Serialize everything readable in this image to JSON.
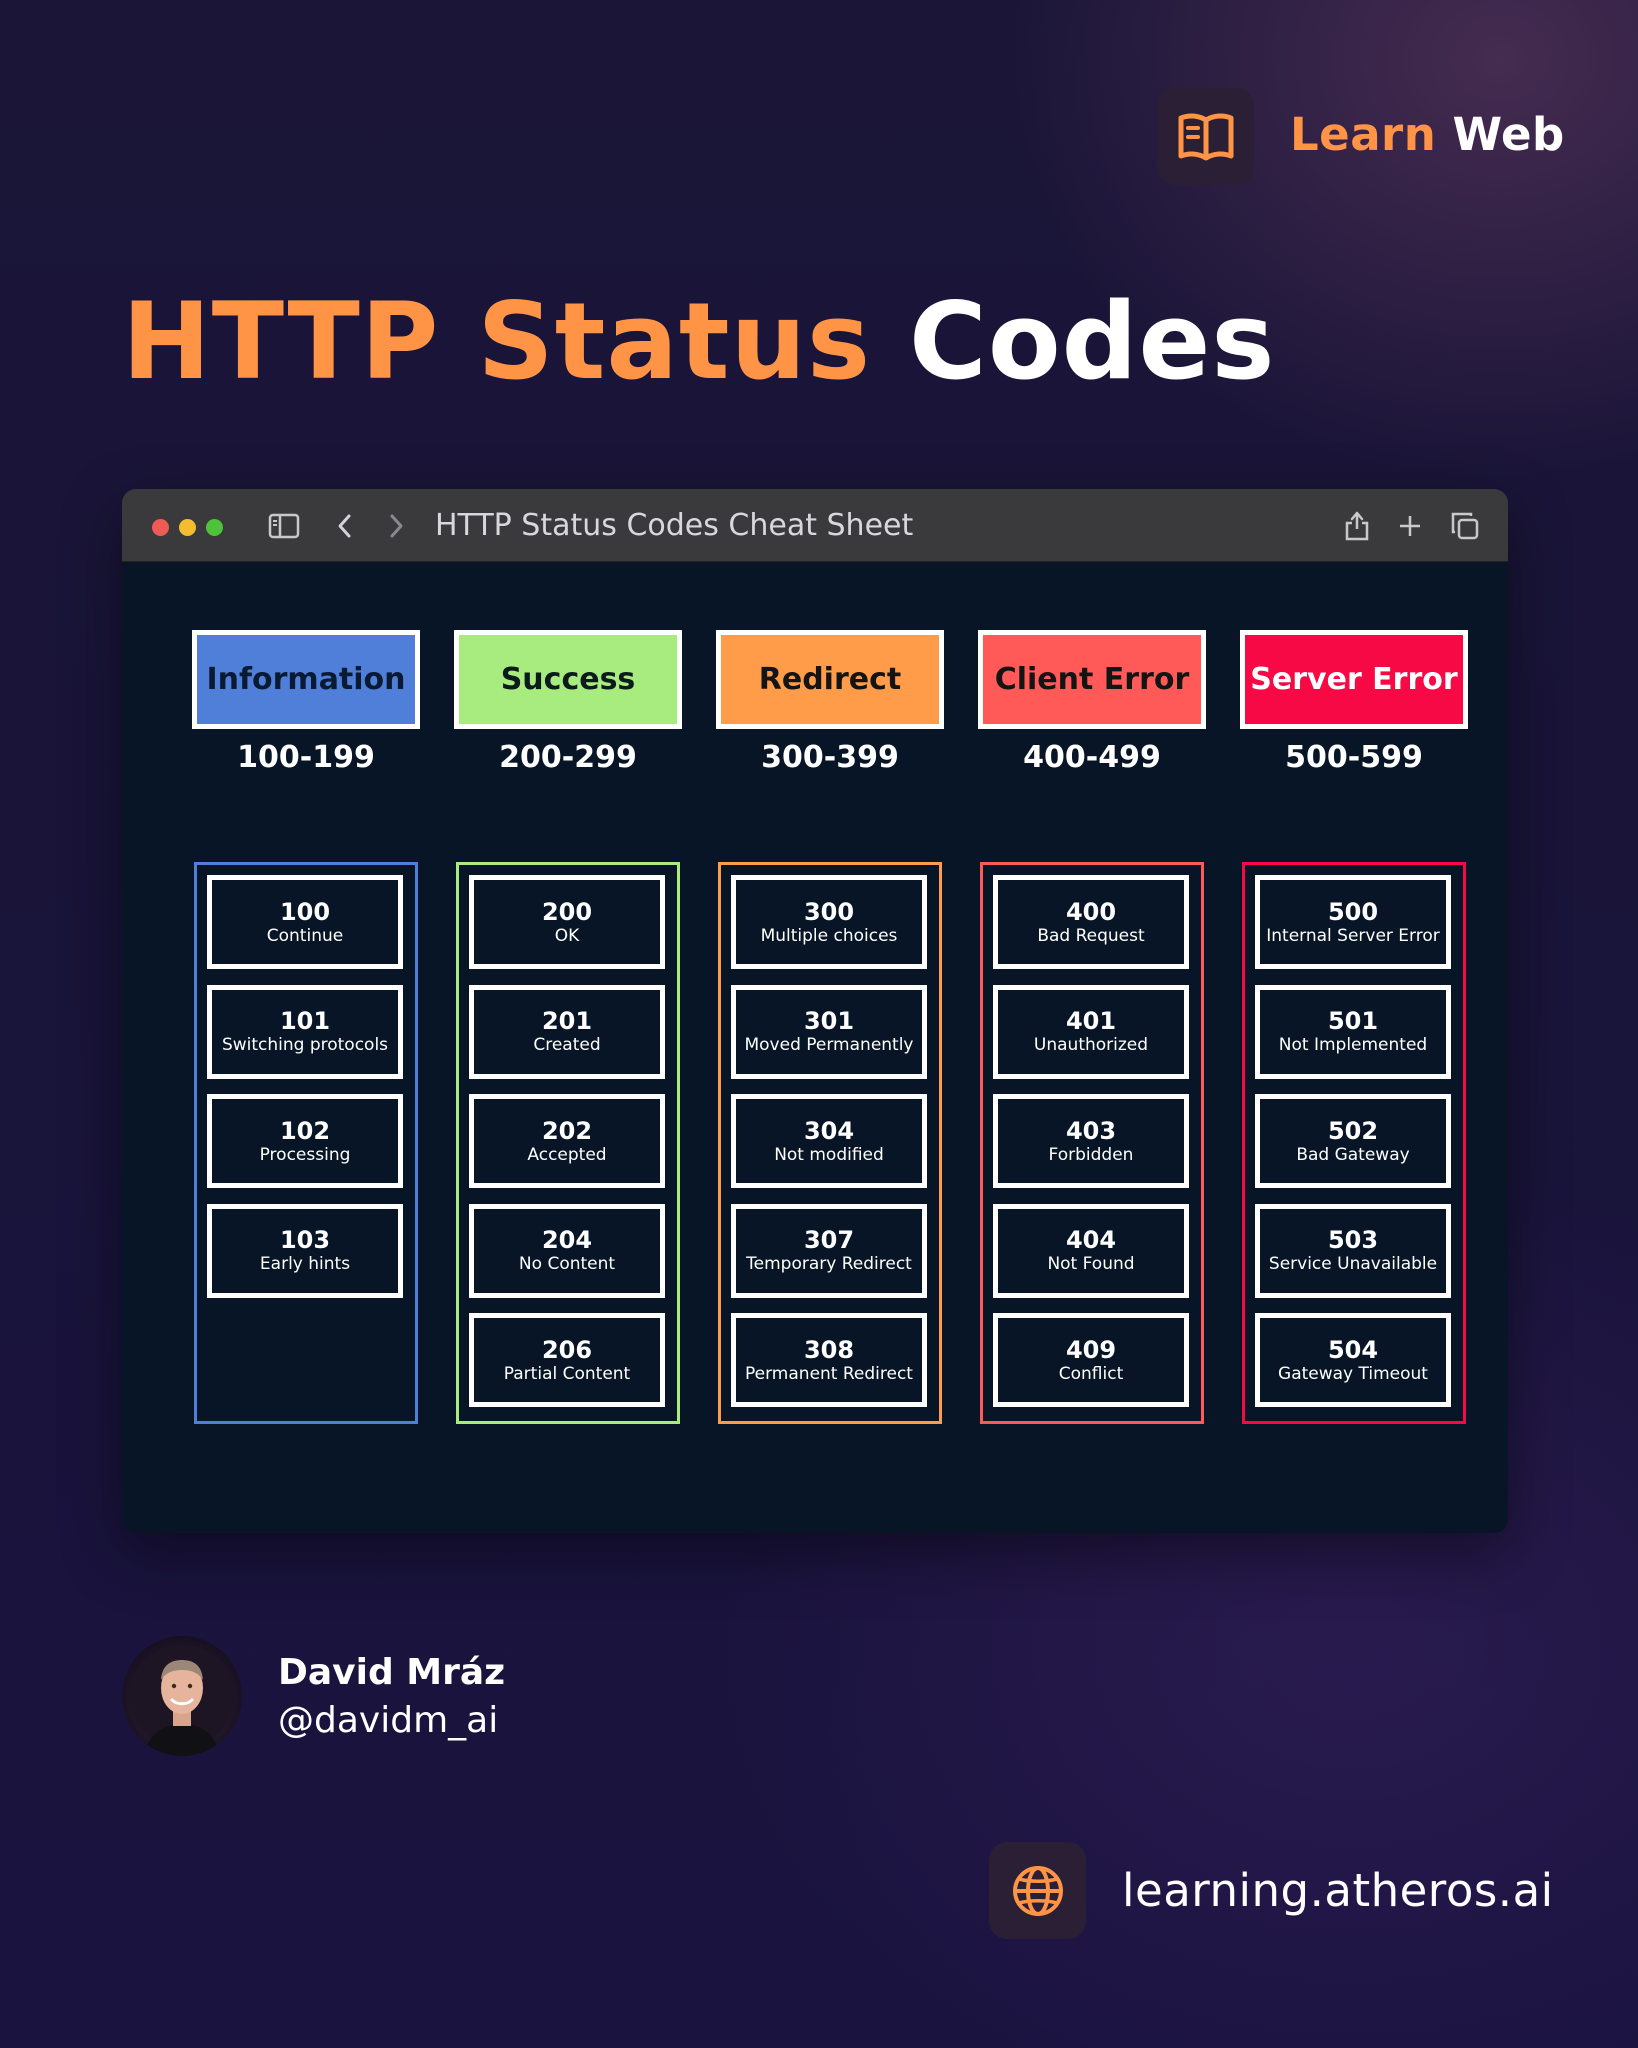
{
  "brand": {
    "learn": "Learn",
    "web": "Web",
    "icon": "open-book-icon",
    "accent_color": "#ff9446"
  },
  "title": {
    "accent": "HTTP Status",
    "rest": "Codes"
  },
  "browser": {
    "tab_title": "HTTP Status Codes Cheat Sheet",
    "icons": [
      "sidebar-icon",
      "back-icon",
      "forward-icon",
      "share-icon",
      "new-tab-icon",
      "tabs-overview-icon"
    ]
  },
  "categories": [
    {
      "name": "Information",
      "range": "100-199",
      "color": "#4f7fd8",
      "text_color": "#0b1a33",
      "codes": [
        {
          "code": "100",
          "label": "Continue"
        },
        {
          "code": "101",
          "label": "Switching protocols"
        },
        {
          "code": "102",
          "label": "Processing"
        },
        {
          "code": "103",
          "label": "Early hints"
        }
      ]
    },
    {
      "name": "Success",
      "range": "200-299",
      "color": "#a8ec7f",
      "text_color": "#0b1a1a",
      "codes": [
        {
          "code": "200",
          "label": "OK"
        },
        {
          "code": "201",
          "label": "Created"
        },
        {
          "code": "202",
          "label": "Accepted"
        },
        {
          "code": "204",
          "label": "No Content"
        },
        {
          "code": "206",
          "label": "Partial Content"
        }
      ]
    },
    {
      "name": "Redirect",
      "range": "300-399",
      "color": "#ff9c4a",
      "text_color": "#141414",
      "codes": [
        {
          "code": "300",
          "label": "Multiple choices"
        },
        {
          "code": "301",
          "label": "Moved Permanently"
        },
        {
          "code": "304",
          "label": "Not modified"
        },
        {
          "code": "307",
          "label": "Temporary Redirect"
        },
        {
          "code": "308",
          "label": "Permanent Redirect"
        }
      ]
    },
    {
      "name": "Client Error",
      "range": "400-499",
      "color": "#ff5a57",
      "text_color": "#141414",
      "codes": [
        {
          "code": "400",
          "label": "Bad Request"
        },
        {
          "code": "401",
          "label": "Unauthorized"
        },
        {
          "code": "403",
          "label": "Forbidden"
        },
        {
          "code": "404",
          "label": "Not Found"
        },
        {
          "code": "409",
          "label": "Conflict"
        }
      ]
    },
    {
      "name": "Server Error",
      "range": "500-599",
      "color": "#f60944",
      "text_color": "#ffffff",
      "codes": [
        {
          "code": "500",
          "label": "Internal Server Error"
        },
        {
          "code": "501",
          "label": "Not Implemented"
        },
        {
          "code": "502",
          "label": "Bad Gateway"
        },
        {
          "code": "503",
          "label": "Service Unavailable"
        },
        {
          "code": "504",
          "label": "Gateway Timeout"
        }
      ]
    }
  ],
  "author": {
    "name": "David Mráz",
    "handle": "@davidm_ai"
  },
  "footer": {
    "url": "learning.atheros.ai",
    "icon": "globe-icon"
  }
}
